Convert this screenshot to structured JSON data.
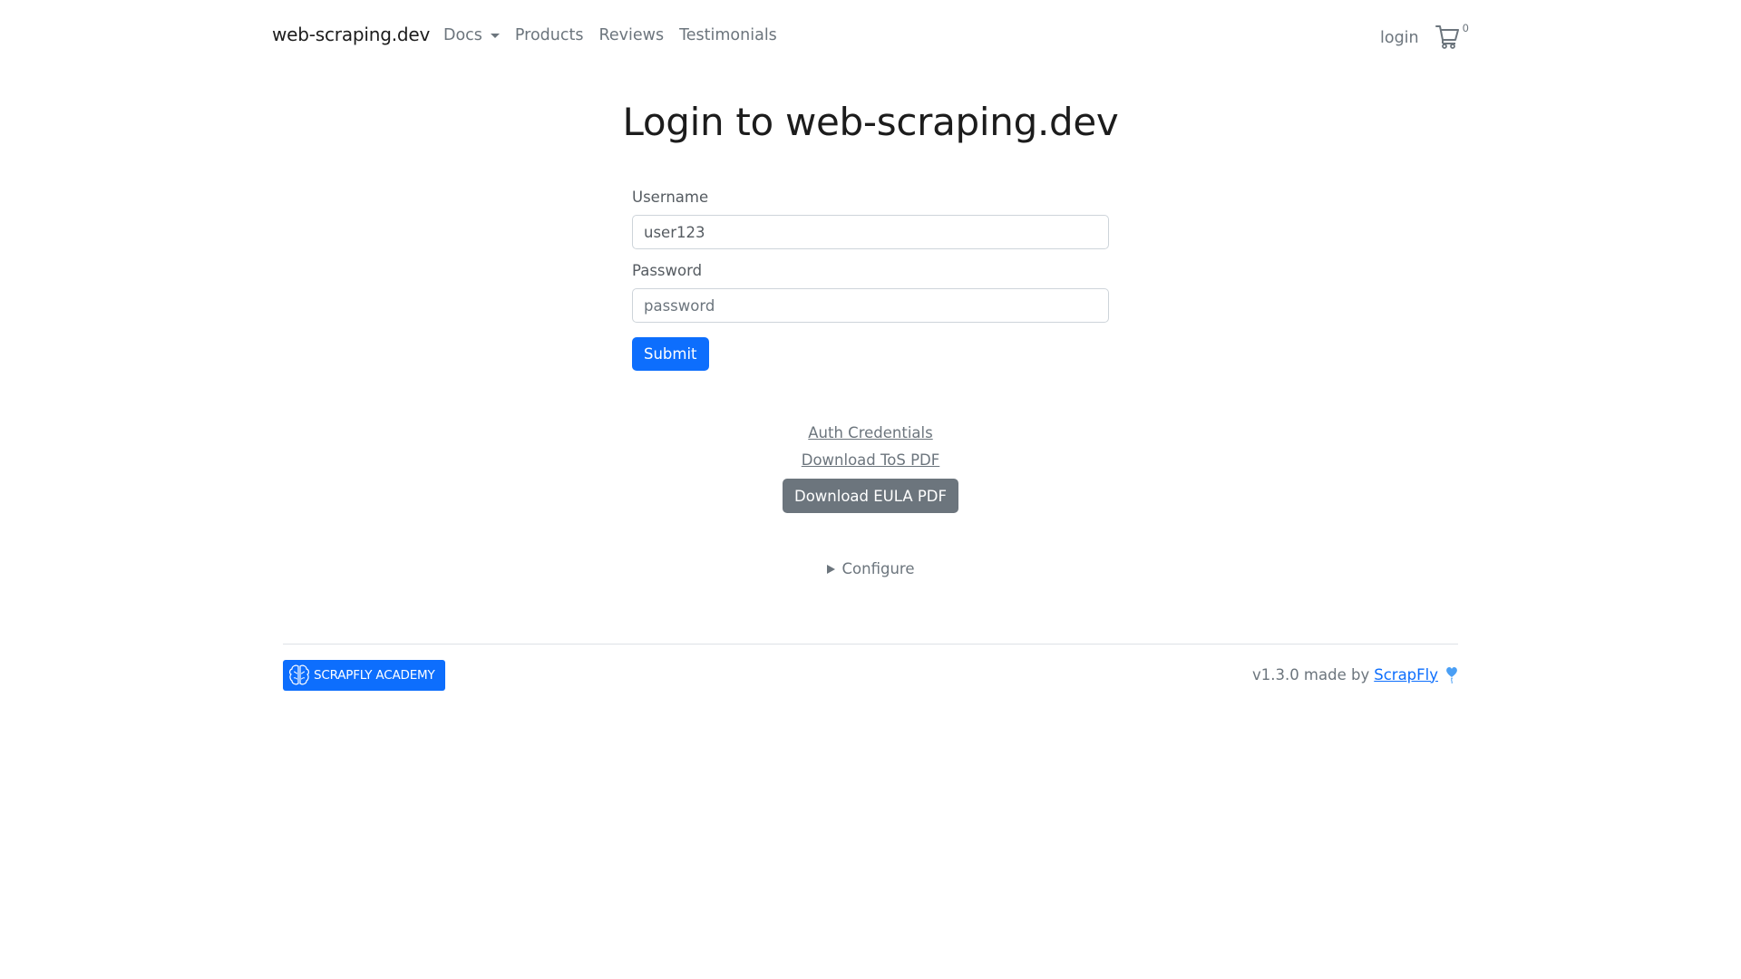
{
  "navbar": {
    "brand": "web-scraping.dev",
    "links": [
      {
        "label": "Docs",
        "has_dropdown": true
      },
      {
        "label": "Products"
      },
      {
        "label": "Reviews"
      },
      {
        "label": "Testimonials"
      }
    ],
    "login_label": "login",
    "cart_icon": "cart-icon",
    "cart_count": "0"
  },
  "page": {
    "title": "Login to web-scraping.dev"
  },
  "form": {
    "username_label": "Username",
    "username_value": "user123",
    "password_label": "Password",
    "password_placeholder": "password",
    "submit_label": "Submit"
  },
  "links": {
    "auth_credentials": "Auth Credentials",
    "download_tos": "Download ToS PDF",
    "download_eula": "Download EULA PDF"
  },
  "configure": {
    "label": "Configure",
    "icon": "triangle-right-icon"
  },
  "footer": {
    "academy_label": "SCRAPFLY ACADEMY",
    "academy_icon": "brain-icon",
    "version_text": "v1.3.0 made by",
    "maker_link": "ScrapFly",
    "maker_icon": "balloon-heart-icon",
    "colors": {
      "primary": "#0d6efd",
      "secondary": "#6c757d"
    }
  }
}
